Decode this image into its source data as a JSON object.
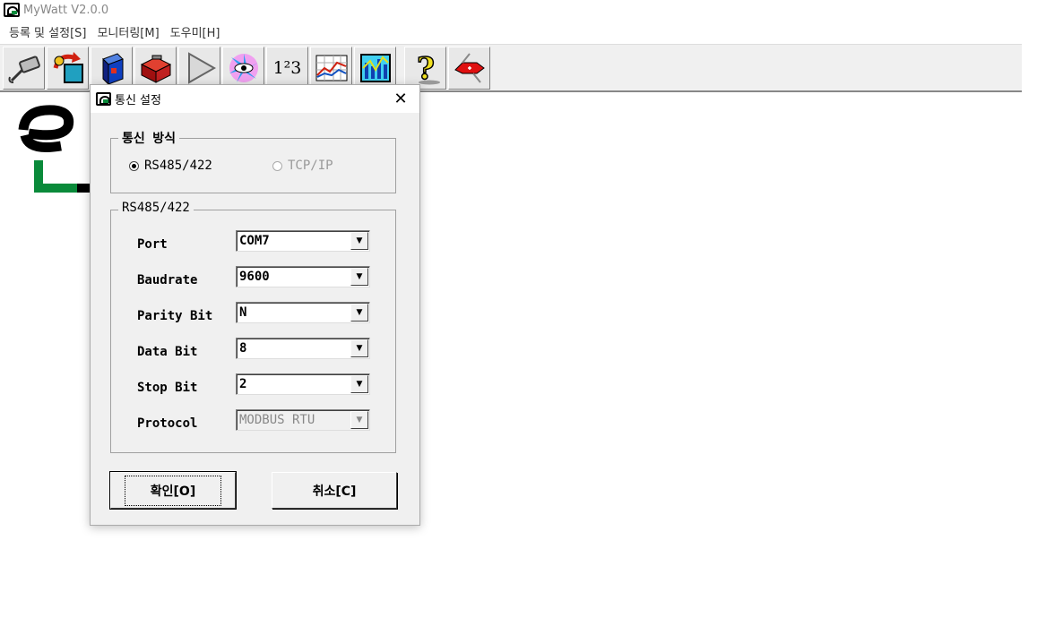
{
  "app": {
    "title": "MyWatt V2.0.0"
  },
  "menu": [
    {
      "label": "등록 및 설정[S]"
    },
    {
      "label": "모니터링[M]"
    },
    {
      "label": "도우미[H]"
    }
  ],
  "toolbar": [
    {
      "icon": "cable-connect-icon"
    },
    {
      "icon": "refresh-box-icon"
    },
    {
      "icon": "blue-book-icon"
    },
    {
      "icon": "red-toolbox-icon"
    },
    {
      "icon": "play-icon"
    },
    {
      "icon": "color-eye-icon"
    },
    {
      "icon": "numbers-123-icon",
      "text": "1²3"
    },
    {
      "icon": "line-graph-icon"
    },
    {
      "icon": "bar-graph-icon"
    },
    {
      "icon": "help-question-icon"
    },
    {
      "icon": "knife-tool-icon"
    }
  ],
  "dialog": {
    "title": "통신 설정",
    "group1_title": "통신 방식",
    "radio_rs": "RS485/422",
    "radio_tcp": "TCP/IP",
    "group2_title": "RS485/422",
    "fields": [
      {
        "label": "Port",
        "value": "COM7"
      },
      {
        "label": "Baudrate",
        "value": "9600"
      },
      {
        "label": "Parity Bit",
        "value": "N"
      },
      {
        "label": "Data Bit",
        "value": "8"
      },
      {
        "label": "Stop Bit",
        "value": "2"
      },
      {
        "label": "Protocol",
        "value": "MODBUS RTU"
      }
    ],
    "ok_label": "확인[O]",
    "cancel_label": "취소[C]"
  },
  "colors": {
    "accent_green": "#0a8a3a",
    "accent_blue": "#0a5fd0"
  }
}
